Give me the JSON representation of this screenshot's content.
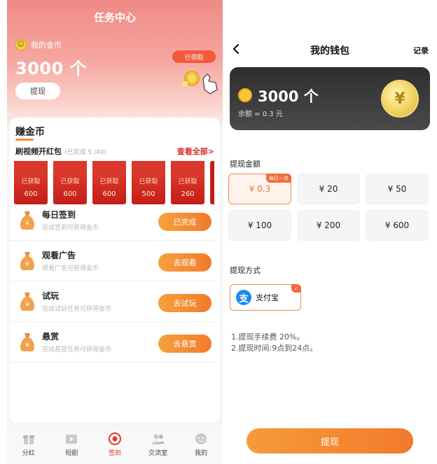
{
  "left": {
    "title": "任务中心",
    "coin_label": "我的金币",
    "coin_amount": "3000 个",
    "withdraw_label": "提现",
    "received_badge": "已领取",
    "earn_title": "赚金币",
    "video_title": "刷视频开红包",
    "video_progress": "(已完成 5 /40)",
    "see_all": "查看全部>",
    "packets": [
      {
        "status": "已获取",
        "amount": "600"
      },
      {
        "status": "已获取",
        "amount": "600"
      },
      {
        "status": "已获取",
        "amount": "600"
      },
      {
        "status": "已获取",
        "amount": "500"
      },
      {
        "status": "已获取",
        "amount": "260"
      }
    ],
    "tasks": [
      {
        "title": "每日签到",
        "desc": "完成签到可获得金币",
        "button": "已完成"
      },
      {
        "title": "观看广告",
        "desc": "观看广告可获得金币",
        "button": "去观看"
      },
      {
        "title": "试玩",
        "desc": "完成试玩任务可获得金币",
        "button": "去试玩"
      },
      {
        "title": "悬赏",
        "desc": "完成悬赏任务可获得金币",
        "button": "去悬赏"
      }
    ],
    "tabs": [
      {
        "label": "分红",
        "icon": "gift-icon"
      },
      {
        "label": "短剧",
        "icon": "video-icon"
      },
      {
        "label": "签到",
        "icon": "checkin-icon"
      },
      {
        "label": "交流室",
        "icon": "people-icon"
      },
      {
        "label": "我的",
        "icon": "profile-icon"
      }
    ],
    "active_tab": "签到"
  },
  "right": {
    "title": "我的钱包",
    "records": "记录",
    "back_icon": "chevron-left-icon",
    "wallet_amount": "3000 个",
    "wallet_balance": "余额 ≈ 0.3 元",
    "amount_section": "提现金额",
    "amounts": [
      {
        "label": "¥ 0.3",
        "tag": "每日一次",
        "selected": true
      },
      {
        "label": "¥ 20"
      },
      {
        "label": "¥ 50"
      },
      {
        "label": "¥ 100"
      },
      {
        "label": "¥ 200"
      },
      {
        "label": "¥ 600"
      }
    ],
    "method_section": "提现方式",
    "method": "支付宝",
    "note_1": "1.提现手续费 20%。",
    "note_2": "2.提现时间:9点到24点。",
    "submit": "提现"
  },
  "colors": {
    "accent_orange": "#f27a2c",
    "hero_pink": "#f08a86",
    "red_text": "#d8302a",
    "packet_red": "#c41e16",
    "alipay_blue": "#1a8cf0",
    "wallet_dark": "#2e2e2e"
  }
}
